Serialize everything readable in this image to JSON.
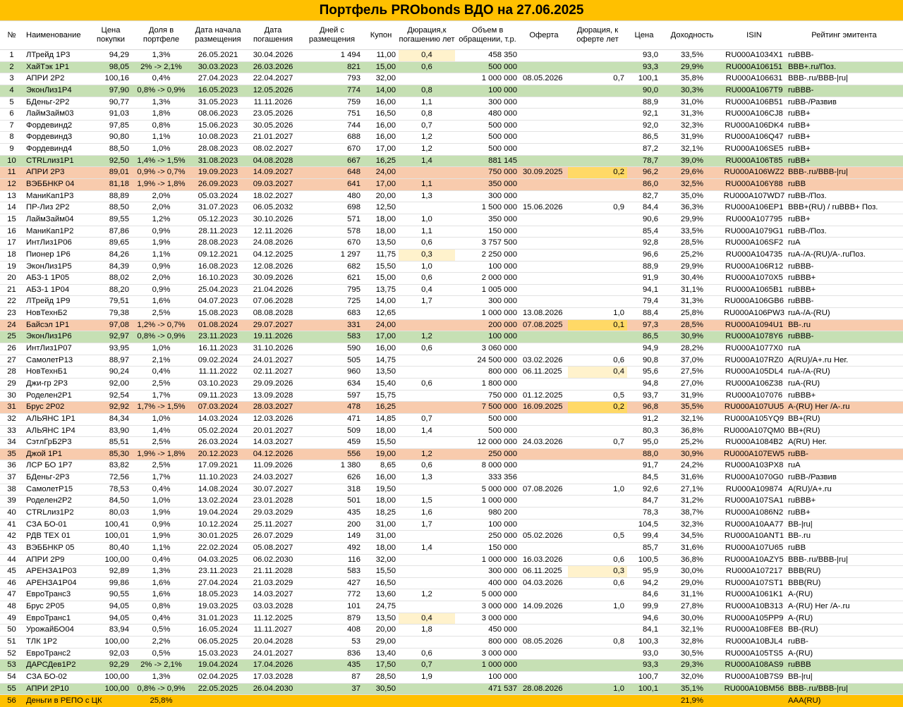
{
  "title": "Портфель PRObonds ВДО на 27.06.2025",
  "columns": [
    "№",
    "Наименование",
    "Цена покупки",
    "Доля в портфеле",
    "Дата начала размещения",
    "Дата погашения",
    "Дней с размещения",
    "Купон",
    "Дюрация,к погашению лет",
    "Объем в обращении, т.р.",
    "Оферта",
    "Дюрация, к оферте лет",
    "Цена",
    "Доходность",
    "ISIN",
    "Рейтинг эмитента"
  ],
  "colors": {
    "title_bg": "#FFC000",
    "row_green": "#C6E0B4",
    "row_orange": "#F8CBAD",
    "cell_light": "#FFF2CC",
    "cell_yellow": "#FFD966"
  },
  "rows": [
    {
      "c": [
        "1",
        "ЛТрейд 1Р3",
        "94,29",
        "1,3%",
        "26.05.2021",
        "30.04.2026",
        "1 494",
        "11,00",
        "0,4",
        "458 350",
        "",
        "",
        "93,0",
        "33,5%",
        "RU000A1034X1",
        "ruBBB-"
      ],
      "hl": {
        "8": "hl"
      }
    },
    {
      "c": [
        "2",
        "ХайТэк 1Р1",
        "98,05",
        "2% -> 2,1%",
        "30.03.2023",
        "26.03.2026",
        "821",
        "15,00",
        "0,6",
        "500 000",
        "",
        "",
        "93,3",
        "29,9%",
        "RU000A106151",
        "BBB+.ru/Поз."
      ],
      "row": "green"
    },
    {
      "c": [
        "3",
        "АПРИ 2Р2",
        "100,16",
        "0,4%",
        "27.04.2023",
        "22.04.2027",
        "793",
        "32,00",
        "",
        "1 000 000",
        "08.05.2026",
        "0,7",
        "100,1",
        "35,8%",
        "RU000A106631",
        "BBB-.ru/BBB-|ru|"
      ]
    },
    {
      "c": [
        "4",
        "ЭконЛиз1Р4",
        "97,90",
        "0,8% -> 0,9%",
        "16.05.2023",
        "12.05.2026",
        "774",
        "14,00",
        "0,8",
        "100 000",
        "",
        "",
        "90,0",
        "30,3%",
        "RU000A1067T9",
        "ruBBB-"
      ],
      "row": "green"
    },
    {
      "c": [
        "5",
        "БДеньг-2Р2",
        "90,77",
        "1,3%",
        "31.05.2023",
        "11.11.2026",
        "759",
        "16,00",
        "1,1",
        "300 000",
        "",
        "",
        "88,9",
        "31,0%",
        "RU000A106B51",
        "ruBB-/Развив"
      ]
    },
    {
      "c": [
        "6",
        "ЛаймЗайм03",
        "91,03",
        "1,8%",
        "08.06.2023",
        "23.05.2026",
        "751",
        "16,50",
        "0,8",
        "480 000",
        "",
        "",
        "92,1",
        "31,3%",
        "RU000A106CJ8",
        "ruBB+"
      ]
    },
    {
      "c": [
        "7",
        "Фордевинд2",
        "97,85",
        "0,8%",
        "15.06.2023",
        "30.05.2026",
        "744",
        "16,00",
        "0,7",
        "500 000",
        "",
        "",
        "92,0",
        "32,3%",
        "RU000A106DK4",
        "ruBB+"
      ]
    },
    {
      "c": [
        "8",
        "Фордевинд3",
        "90,80",
        "1,1%",
        "10.08.2023",
        "21.01.2027",
        "688",
        "16,00",
        "1,2",
        "500 000",
        "",
        "",
        "86,5",
        "31,9%",
        "RU000A106Q47",
        "ruBB+"
      ]
    },
    {
      "c": [
        "9",
        "Фордевинд4",
        "88,50",
        "1,0%",
        "28.08.2023",
        "08.02.2027",
        "670",
        "17,00",
        "1,2",
        "500 000",
        "",
        "",
        "87,2",
        "32,1%",
        "RU000A106SE5",
        "ruBB+"
      ]
    },
    {
      "c": [
        "10",
        "CTRLлиз1Р1",
        "92,50",
        "1,4% -> 1,5%",
        "31.08.2023",
        "04.08.2028",
        "667",
        "16,25",
        "1,4",
        "881 145",
        "",
        "",
        "78,7",
        "39,0%",
        "RU000A106T85",
        "ruBB+"
      ],
      "row": "green"
    },
    {
      "c": [
        "11",
        "АПРИ 2Р3",
        "89,01",
        "0,9% -> 0,7%",
        "19.09.2023",
        "14.09.2027",
        "648",
        "24,00",
        "",
        "750 000",
        "30.09.2025",
        "0,2",
        "96,2",
        "29,6%",
        "RU000A106WZ2",
        "BBB-.ru/BBB-|ru|"
      ],
      "row": "orange",
      "hl": {
        "11": "hl2"
      }
    },
    {
      "c": [
        "12",
        "ВЭББНКР 04",
        "81,18",
        "1,9% -> 1,8%",
        "26.09.2023",
        "09.03.2027",
        "641",
        "17,00",
        "1,1",
        "350 000",
        "",
        "",
        "86,0",
        "32,5%",
        "RU000A106Y88",
        "ruBB"
      ],
      "row": "orange"
    },
    {
      "c": [
        "13",
        "МаниКап1Р3",
        "88,89",
        "2,0%",
        "05.03.2024",
        "18.02.2027",
        "480",
        "20,00",
        "1,3",
        "300 000",
        "",
        "",
        "82,7",
        "35,0%",
        "RU000A107WD7",
        "ruBB-/Поз."
      ]
    },
    {
      "c": [
        "14",
        "ПР-Лиз 2Р2",
        "88,50",
        "2,0%",
        "31.07.2023",
        "06.05.2032",
        "698",
        "12,50",
        "",
        "1 500 000",
        "15.06.2026",
        "0,9",
        "84,4",
        "36,3%",
        "RU000A106EP1",
        "BBB+(RU) / ruBBB+ Поз."
      ]
    },
    {
      "c": [
        "15",
        "ЛаймЗайм04",
        "89,55",
        "1,2%",
        "05.12.2023",
        "30.10.2026",
        "571",
        "18,00",
        "1,0",
        "350 000",
        "",
        "",
        "90,6",
        "29,9%",
        "RU000A107795",
        "ruBB+"
      ]
    },
    {
      "c": [
        "16",
        "МаниКап1Р2",
        "87,86",
        "0,9%",
        "28.11.2023",
        "12.11.2026",
        "578",
        "18,00",
        "1,1",
        "150 000",
        "",
        "",
        "85,4",
        "33,5%",
        "RU000A1079G1",
        "ruBB-/Поз."
      ]
    },
    {
      "c": [
        "17",
        "ИнтЛиз1Р06",
        "89,65",
        "1,9%",
        "28.08.2023",
        "24.08.2026",
        "670",
        "13,50",
        "0,6",
        "3 757 500",
        "",
        "",
        "92,8",
        "28,5%",
        "RU000A106SF2",
        "ruA"
      ]
    },
    {
      "c": [
        "18",
        "Пионер 1Р6",
        "84,26",
        "1,1%",
        "09.12.2021",
        "04.12.2025",
        "1 297",
        "11,75",
        "0,3",
        "2 250 000",
        "",
        "",
        "96,6",
        "25,2%",
        "RU000A104735",
        "ruA-/A-(RU)/A-.ruПоз."
      ],
      "hl": {
        "8": "hl"
      }
    },
    {
      "c": [
        "19",
        "ЭконЛиз1Р5",
        "84,39",
        "0,9%",
        "16.08.2023",
        "12.08.2026",
        "682",
        "15,50",
        "1,0",
        "100 000",
        "",
        "",
        "88,9",
        "29,9%",
        "RU000A106R12",
        "ruBBB-"
      ]
    },
    {
      "c": [
        "20",
        "АБЗ-1 1Р05",
        "88,02",
        "2,0%",
        "16.10.2023",
        "30.09.2026",
        "621",
        "15,00",
        "0,6",
        "2 000 000",
        "",
        "",
        "91,9",
        "30,4%",
        "RU000A1070X5",
        "ruBBB+"
      ]
    },
    {
      "c": [
        "21",
        "АБЗ-1 1Р04",
        "88,20",
        "0,9%",
        "25.04.2023",
        "21.04.2026",
        "795",
        "13,75",
        "0,4",
        "1 005 000",
        "",
        "",
        "94,1",
        "31,1%",
        "RU000A1065B1",
        "ruBBB+"
      ]
    },
    {
      "c": [
        "22",
        "ЛТрейд 1Р9",
        "79,51",
        "1,6%",
        "04.07.2023",
        "07.06.2028",
        "725",
        "14,00",
        "1,7",
        "300 000",
        "",
        "",
        "79,4",
        "31,3%",
        "RU000A106GB6",
        "ruBBB-"
      ]
    },
    {
      "c": [
        "23",
        "НовТехнБ2",
        "79,38",
        "2,5%",
        "15.08.2023",
        "08.08.2028",
        "683",
        "12,65",
        "",
        "1 000 000",
        "13.08.2026",
        "1,0",
        "88,4",
        "25,8%",
        "RU000A106PW3",
        "ruA-/A-(RU)"
      ]
    },
    {
      "c": [
        "24",
        "Байсэл 1Р1",
        "97,08",
        "1,2% -> 0,7%",
        "01.08.2024",
        "29.07.2027",
        "331",
        "24,00",
        "",
        "200 000",
        "07.08.2025",
        "0,1",
        "97,3",
        "28,5%",
        "RU000A1094U1",
        "BB-.ru"
      ],
      "row": "orange",
      "hl": {
        "11": "hl2"
      }
    },
    {
      "c": [
        "25",
        "ЭконЛиз1Р6",
        "92,97",
        "0,8% -> 0,9%",
        "23.11.2023",
        "19.11.2026",
        "583",
        "17,00",
        "1,2",
        "100 000",
        "",
        "",
        "86,5",
        "30,9%",
        "RU000A1078Y6",
        "ruBBB-"
      ],
      "row": "green"
    },
    {
      "c": [
        "26",
        "ИнтЛиз1Р07",
        "93,95",
        "1,0%",
        "16.11.2023",
        "31.10.2026",
        "590",
        "16,00",
        "0,6",
        "3 060 000",
        "",
        "",
        "94,9",
        "28,2%",
        "RU000A1077X0",
        "ruA"
      ]
    },
    {
      "c": [
        "27",
        "СамолетР13",
        "88,97",
        "2,1%",
        "09.02.2024",
        "24.01.2027",
        "505",
        "14,75",
        "",
        "24 500 000",
        "03.02.2026",
        "0,6",
        "90,8",
        "37,0%",
        "RU000A107RZ0",
        "A(RU)/A+.ru Нег."
      ]
    },
    {
      "c": [
        "28",
        "НовТехнБ1",
        "90,24",
        "0,4%",
        "11.11.2022",
        "02.11.2027",
        "960",
        "13,50",
        "",
        "800 000",
        "06.11.2025",
        "0,4",
        "95,6",
        "27,5%",
        "RU000A105DL4",
        "ruA-/A-(RU)"
      ],
      "hl": {
        "11": "hl"
      }
    },
    {
      "c": [
        "29",
        "Джи-гр 2Р3",
        "92,00",
        "2,5%",
        "03.10.2023",
        "29.09.2026",
        "634",
        "15,40",
        "0,6",
        "1 800 000",
        "",
        "",
        "94,8",
        "27,0%",
        "RU000A106Z38",
        "ruA-(RU)"
      ]
    },
    {
      "c": [
        "30",
        "Роделен2Р1",
        "92,54",
        "1,7%",
        "09.11.2023",
        "13.09.2028",
        "597",
        "15,75",
        "",
        "750 000",
        "01.12.2025",
        "0,5",
        "93,7",
        "31,9%",
        "RU000A107076",
        "ruBBB+"
      ]
    },
    {
      "c": [
        "31",
        "Брус 2Р02",
        "92,92",
        "1,7% -> 1,5%",
        "07.03.2024",
        "28.03.2027",
        "478",
        "16,25",
        "",
        "7 500 000",
        "16.09.2025",
        "0,2",
        "96,8",
        "35,5%",
        "RU000A107UU5",
        "A-(RU) Нег /A-.ru"
      ],
      "row": "orange",
      "hl": {
        "11": "hl2"
      }
    },
    {
      "c": [
        "32",
        "АЛЬЯНС 1Р1",
        "84,34",
        "1,0%",
        "14.03.2024",
        "12.03.2026",
        "471",
        "14,85",
        "0,7",
        "500 000",
        "",
        "",
        "91,2",
        "32,1%",
        "RU000A105YQ9",
        "BB+(RU)"
      ]
    },
    {
      "c": [
        "33",
        "АЛЬЯНС 1Р4",
        "83,90",
        "1,4%",
        "05.02.2024",
        "20.01.2027",
        "509",
        "18,00",
        "1,4",
        "500 000",
        "",
        "",
        "80,3",
        "36,8%",
        "RU000A107QM0",
        "BB+(RU)"
      ]
    },
    {
      "c": [
        "34",
        "СэтлГрБ2Р3",
        "85,51",
        "2,5%",
        "26.03.2024",
        "14.03.2027",
        "459",
        "15,50",
        "",
        "12 000 000",
        "24.03.2026",
        "0,7",
        "95,0",
        "25,2%",
        "RU000A1084B2",
        "A(RU) Нег."
      ]
    },
    {
      "c": [
        "35",
        "Джой 1Р1",
        "85,30",
        "1,9% -> 1,8%",
        "20.12.2023",
        "04.12.2026",
        "556",
        "19,00",
        "1,2",
        "250 000",
        "",
        "",
        "88,0",
        "30,9%",
        "RU000A107EW5",
        "ruBB-"
      ],
      "row": "orange"
    },
    {
      "c": [
        "36",
        "ЛСР БО 1Р7",
        "83,82",
        "2,5%",
        "17.09.2021",
        "11.09.2026",
        "1 380",
        "8,65",
        "0,6",
        "8 000 000",
        "",
        "",
        "91,7",
        "24,2%",
        "RU000A103PX8",
        "ruA"
      ]
    },
    {
      "c": [
        "37",
        "БДеньг-2Р3",
        "72,56",
        "1,7%",
        "11.10.2023",
        "24.03.2027",
        "626",
        "16,00",
        "1,3",
        "333 356",
        "",
        "",
        "84,5",
        "31,6%",
        "RU000A1070G0",
        "ruBB-/Развив"
      ]
    },
    {
      "c": [
        "38",
        "СамолетР15",
        "78,53",
        "0,4%",
        "14.08.2024",
        "30.07.2027",
        "318",
        "19,50",
        "",
        "5 000 000",
        "07.08.2026",
        "1,0",
        "92,6",
        "27,1%",
        "RU000A109874",
        "A(RU)/A+.ru"
      ]
    },
    {
      "c": [
        "39",
        "Роделен2Р2",
        "84,50",
        "1,0%",
        "13.02.2024",
        "23.01.2028",
        "501",
        "18,00",
        "1,5",
        "1 000 000",
        "",
        "",
        "84,7",
        "31,2%",
        "RU000A107SA1",
        "ruBBB+"
      ]
    },
    {
      "c": [
        "40",
        "CTRLлиз1Р2",
        "80,03",
        "1,9%",
        "19.04.2024",
        "29.03.2029",
        "435",
        "18,25",
        "1,6",
        "980 200",
        "",
        "",
        "78,3",
        "38,7%",
        "RU000A1086N2",
        "ruBB+"
      ]
    },
    {
      "c": [
        "41",
        "СЗА БО-01",
        "100,41",
        "0,9%",
        "10.12.2024",
        "25.11.2027",
        "200",
        "31,00",
        "1,7",
        "100 000",
        "",
        "",
        "104,5",
        "32,3%",
        "RU000A10AA77",
        "BB-|ru|"
      ]
    },
    {
      "c": [
        "42",
        "РДВ ТЕХ 01",
        "100,01",
        "1,9%",
        "30.01.2025",
        "26.07.2029",
        "149",
        "31,00",
        "",
        "250 000",
        "05.02.2026",
        "0,5",
        "99,4",
        "34,5%",
        "RU000A10ANT1",
        "BB-.ru"
      ]
    },
    {
      "c": [
        "43",
        "ВЭББНКР 05",
        "80,40",
        "1,1%",
        "22.02.2024",
        "05.08.2027",
        "492",
        "18,00",
        "1,4",
        "150 000",
        "",
        "",
        "85,7",
        "31,6%",
        "RU000A107U65",
        "ruBB"
      ]
    },
    {
      "c": [
        "44",
        "АПРИ 2Р9",
        "100,00",
        "0,4%",
        "04.03.2025",
        "06.02.2030",
        "116",
        "32,00",
        "",
        "1 000 000",
        "16.03.2026",
        "0,6",
        "100,5",
        "36,8%",
        "RU000A10AZY5",
        "BBB-.ru/BBB-|ru|"
      ]
    },
    {
      "c": [
        "45",
        "АРЕНЗА1Р03",
        "92,89",
        "1,3%",
        "23.11.2023",
        "21.11.2028",
        "583",
        "15,50",
        "",
        "300 000",
        "06.11.2025",
        "0,3",
        "95,9",
        "30,0%",
        "RU000A107217",
        "BBB(RU)"
      ],
      "hl": {
        "11": "hl"
      }
    },
    {
      "c": [
        "46",
        "АРЕНЗА1Р04",
        "99,86",
        "1,6%",
        "27.04.2024",
        "21.03.2029",
        "427",
        "16,50",
        "",
        "400 000",
        "04.03.2026",
        "0,6",
        "94,2",
        "29,0%",
        "RU000A107ST1",
        "BBB(RU)"
      ]
    },
    {
      "c": [
        "47",
        "ЕвроТранс3",
        "90,55",
        "1,6%",
        "18.05.2023",
        "14.03.2027",
        "772",
        "13,60",
        "1,2",
        "5 000 000",
        "",
        "",
        "84,6",
        "31,1%",
        "RU000A1061K1",
        "A-(RU)"
      ]
    },
    {
      "c": [
        "48",
        "Брус 2Р05",
        "94,05",
        "0,8%",
        "19.03.2025",
        "03.03.2028",
        "101",
        "24,75",
        "",
        "3 000 000",
        "14.09.2026",
        "1,0",
        "99,9",
        "27,8%",
        "RU000A10B313",
        "A-(RU) Нег /A-.ru"
      ]
    },
    {
      "c": [
        "49",
        "ЕвроТранс1",
        "94,05",
        "0,4%",
        "31.01.2023",
        "11.12.2025",
        "879",
        "13,50",
        "0,4",
        "3 000 000",
        "",
        "",
        "94,6",
        "30,0%",
        "RU000A105PP9",
        "A-(RU)"
      ],
      "hl": {
        "8": "hl"
      }
    },
    {
      "c": [
        "50",
        "УрожайБО04",
        "83,94",
        "0,5%",
        "16.05.2024",
        "11.11.2027",
        "408",
        "20,00",
        "1,8",
        "450 000",
        "",
        "",
        "84,1",
        "32,1%",
        "RU000A108FE8",
        "BB-(RU)"
      ]
    },
    {
      "c": [
        "51",
        "ТЛК 1Р2",
        "100,00",
        "2,2%",
        "06.05.2025",
        "20.04.2028",
        "53",
        "29,00",
        "",
        "800 000",
        "08.05.2026",
        "0,8",
        "100,3",
        "32,8%",
        "RU000A10BJL4",
        "ruBB-"
      ]
    },
    {
      "c": [
        "52",
        "ЕвроТранс2",
        "92,03",
        "0,5%",
        "15.03.2023",
        "24.01.2027",
        "836",
        "13,40",
        "0,6",
        "3 000 000",
        "",
        "",
        "93,0",
        "30,5%",
        "RU000A105TS5",
        "A-(RU)"
      ]
    },
    {
      "c": [
        "53",
        "ДАРСДев1Р2",
        "92,29",
        "2% -> 2,1%",
        "19.04.2024",
        "17.04.2026",
        "435",
        "17,50",
        "0,7",
        "1 000 000",
        "",
        "",
        "93,3",
        "29,3%",
        "RU000A108AS9",
        "ruBBB"
      ],
      "row": "green"
    },
    {
      "c": [
        "54",
        "СЗА БО-02",
        "100,00",
        "1,3%",
        "02.04.2025",
        "17.03.2028",
        "87",
        "28,50",
        "1,9",
        "100 000",
        "",
        "",
        "100,7",
        "32,0%",
        "RU000A10B7S9",
        "BB-|ru|"
      ]
    },
    {
      "c": [
        "55",
        "АПРИ 2Р10",
        "100,00",
        "0,8% -> 0,9%",
        "22.05.2025",
        "26.04.2030",
        "37",
        "30,50",
        "",
        "471 537",
        "28.08.2026",
        "1,0",
        "100,1",
        "35,1%",
        "RU000A10BM56",
        "BBB-.ru/BBB-|ru|"
      ],
      "row": "green"
    }
  ],
  "total": {
    "num": "56",
    "label": "Деньги в РЕПО с ЦК",
    "share": "25,8%",
    "yield": "21,9%",
    "rating": "AAA(RU)"
  }
}
